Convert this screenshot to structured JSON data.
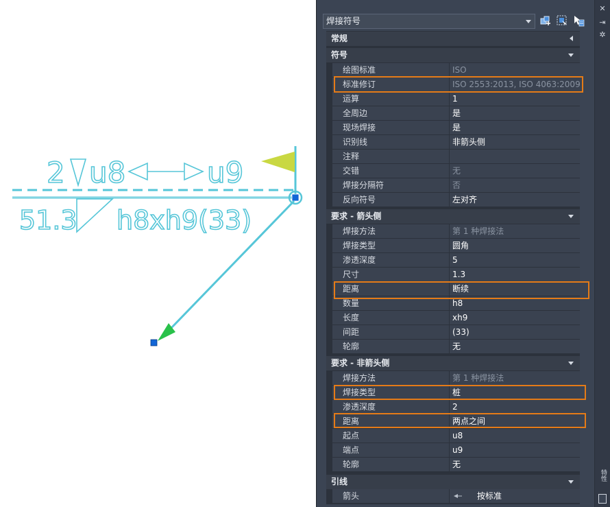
{
  "colors": {
    "accent_outline": "#e57b17",
    "panel_bg": "#3b4453",
    "leader_cyan": "#56c6d8",
    "flag_yellow": "#c9d842",
    "grip_blue": "#1266d6",
    "arrow_green": "#29c14a"
  },
  "drawing": {
    "top_line_text": [
      "2",
      "u8",
      "u9"
    ],
    "bottom_line_text": [
      "51.3",
      "h8xh9(33)"
    ]
  },
  "panel": {
    "object_type": "焊接符号",
    "toolbar_icons": [
      "quick-select-icon",
      "select-objects-icon",
      "toggle-pickadd-icon"
    ],
    "side_icons": [
      "close-icon",
      "pin-icon",
      "settings-icon"
    ],
    "side_tab_label": "特性",
    "sections": {
      "general": "常规",
      "symbol": "符号",
      "arrow_side": "要求 - 箭头侧",
      "other_side": "要求 - 非箭头侧",
      "leader": "引线"
    },
    "symbol_rows": [
      {
        "k": "绘图标准",
        "v": "ISO"
      },
      {
        "k": "标准修订",
        "v": "ISO 2553:2013, ISO 4063:2009"
      },
      {
        "k": "运算",
        "v": "1"
      },
      {
        "k": "全周边",
        "v": "是"
      },
      {
        "k": "现场焊接",
        "v": "是"
      },
      {
        "k": "识别线",
        "v": "非箭头侧"
      },
      {
        "k": "注释",
        "v": ""
      },
      {
        "k": "交错",
        "v": "无"
      },
      {
        "k": "焊接分隔符",
        "v": "否"
      },
      {
        "k": "反向符号",
        "v": "左对齐"
      }
    ],
    "arrow_side_rows": [
      {
        "k": "焊接方法",
        "v": "第 1 种焊接法"
      },
      {
        "k": "焊接类型",
        "v": "圆角"
      },
      {
        "k": "渗透深度",
        "v": "5"
      },
      {
        "k": "尺寸",
        "v": "1.3"
      },
      {
        "k": "距离",
        "v": "断续"
      },
      {
        "k": "数量",
        "v": "h8"
      },
      {
        "k": "长度",
        "v": "xh9"
      },
      {
        "k": "间距",
        "v": "(33)"
      },
      {
        "k": "轮廓",
        "v": "无"
      }
    ],
    "other_side_rows": [
      {
        "k": "焊接方法",
        "v": "第 1 种焊接法"
      },
      {
        "k": "焊接类型",
        "v": "桩"
      },
      {
        "k": "渗透深度",
        "v": "2"
      },
      {
        "k": "距离",
        "v": "两点之间"
      },
      {
        "k": "起点",
        "v": "u8"
      },
      {
        "k": "端点",
        "v": "u9"
      },
      {
        "k": "轮廓",
        "v": "无"
      }
    ],
    "leader_rows": [
      {
        "k": "箭头",
        "v": "按标准"
      }
    ]
  }
}
